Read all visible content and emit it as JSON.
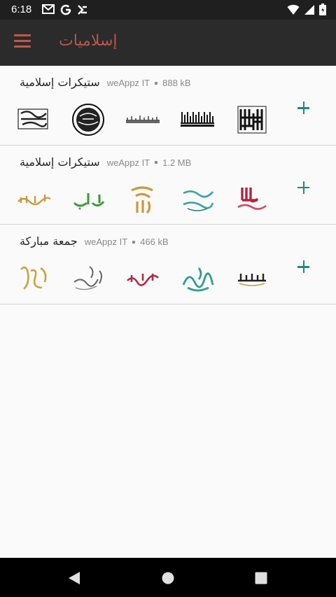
{
  "status_bar": {
    "time": "6:18",
    "left_icons": [
      "gmail-icon",
      "google-icon",
      "download-icon"
    ],
    "right_icons": [
      "wifi-icon",
      "signal-icon",
      "battery-icon"
    ]
  },
  "app_bar": {
    "title": "إسلاميات",
    "menu_icon": "hamburger-menu-icon",
    "accent_color": "#b8574a"
  },
  "packs": [
    {
      "name": "ستيكرات إسلامية",
      "publisher": "weAppz IT",
      "size": "888 kB",
      "add_icon": "plus-icon",
      "stickers": [
        "calligraphy-rectangle",
        "calligraphy-kufi-banner",
        "calligraphy-wide",
        "calligraphy-circle-seal",
        "calligraphy-rectangle-2"
      ]
    },
    {
      "name": "ستيكرات إسلامية",
      "publisher": "weAppz IT",
      "size": "1.2 MB",
      "add_icon": "plus-icon",
      "stickers": [
        "allah-barak-fik",
        "subhan-allah-walhamdulillah",
        "shukran-lillah",
        "ya-rab",
        "alhamdulillah"
      ]
    },
    {
      "name": "جمعة مباركة",
      "publisher": "weAppz IT",
      "size": "466 kB",
      "add_icon": "plus-icon",
      "stickers": [
        "iqra-bismillah",
        "jumuah-green",
        "jumuah-red",
        "jumuah-gray",
        "jumuah-gold"
      ]
    }
  ],
  "nav_bar": {
    "icons": [
      "back-triangle-icon",
      "home-circle-icon",
      "recents-square-icon"
    ]
  }
}
